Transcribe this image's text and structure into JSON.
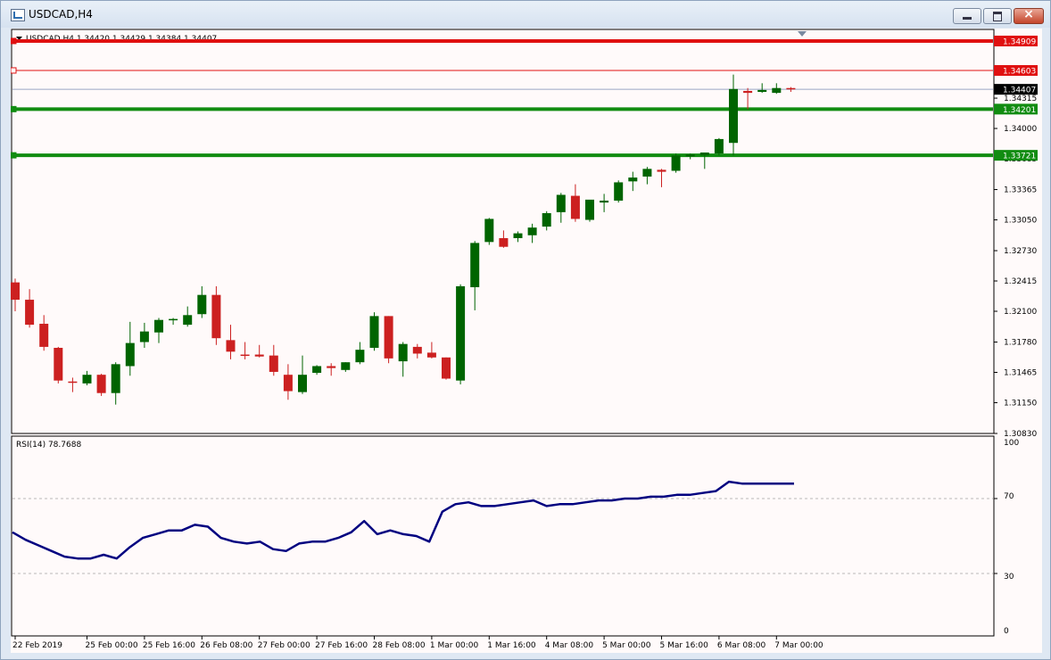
{
  "window": {
    "title": "USDCAD,H4"
  },
  "header": {
    "info": "USDCAD,H4  1.34420 1.34429 1.34384 1.34407"
  },
  "rsi": {
    "label": "RSI(14) 78.7688",
    "levels": [
      30,
      70
    ],
    "ticks": [
      "100",
      "70",
      "30",
      "0"
    ]
  },
  "colors": {
    "bull": "#006400",
    "bear": "#cc2020",
    "support": "#118c11",
    "resistance": "#e01010",
    "rsi_line": "#000080"
  },
  "price_axis_ticks": [
    "1.34315",
    "1.34000",
    "1.33685",
    "1.33365",
    "1.33050",
    "1.32730",
    "1.32415",
    "1.32100",
    "1.31780",
    "1.31465",
    "1.31150",
    "1.30830"
  ],
  "horizontal_lines": [
    {
      "label": "1.34909",
      "value": 1.34909,
      "color": "#e01010",
      "style": "thick"
    },
    {
      "label": "1.34603",
      "value": 1.34603,
      "color": "#e01010",
      "style": "thin"
    },
    {
      "label": "1.34201",
      "value": 1.34201,
      "color": "#118c11",
      "style": "thick"
    },
    {
      "label": "1.33721",
      "value": 1.33721,
      "color": "#118c11",
      "style": "thick"
    }
  ],
  "current_price": {
    "label": "1.34407",
    "value": 1.34407
  },
  "time_labels": [
    {
      "text": "22 Feb 2019",
      "i": 0
    },
    {
      "text": "25 Feb 00:00",
      "i": 5
    },
    {
      "text": "25 Feb 16:00",
      "i": 9
    },
    {
      "text": "26 Feb 08:00",
      "i": 13
    },
    {
      "text": "27 Feb 00:00",
      "i": 17
    },
    {
      "text": "27 Feb 16:00",
      "i": 21
    },
    {
      "text": "28 Feb 08:00",
      "i": 25
    },
    {
      "text": "1 Mar 00:00",
      "i": 29
    },
    {
      "text": "1 Mar 16:00",
      "i": 33
    },
    {
      "text": "4 Mar 08:00",
      "i": 37
    },
    {
      "text": "5 Mar 00:00",
      "i": 41
    },
    {
      "text": "5 Mar 16:00",
      "i": 45
    },
    {
      "text": "6 Mar 08:00",
      "i": 49
    },
    {
      "text": "7 Mar 00:00",
      "i": 53
    }
  ],
  "chart_data": {
    "type": "candlestick",
    "symbol": "USDCAD",
    "timeframe": "H4",
    "ylim": [
      1.3083,
      1.3502
    ],
    "candles": [
      {
        "o": 1.324,
        "h": 1.3244,
        "l": 1.321,
        "c": 1.3222
      },
      {
        "o": 1.3222,
        "h": 1.3233,
        "l": 1.3193,
        "c": 1.3196
      },
      {
        "o": 1.3197,
        "h": 1.3206,
        "l": 1.3169,
        "c": 1.3173
      },
      {
        "o": 1.3172,
        "h": 1.3173,
        "l": 1.3135,
        "c": 1.3138
      },
      {
        "o": 1.3137,
        "h": 1.3141,
        "l": 1.3126,
        "c": 1.3136
      },
      {
        "o": 1.3135,
        "h": 1.3148,
        "l": 1.3133,
        "c": 1.3144
      },
      {
        "o": 1.3144,
        "h": 1.3145,
        "l": 1.3122,
        "c": 1.3125
      },
      {
        "o": 1.3125,
        "h": 1.3157,
        "l": 1.3113,
        "c": 1.3155
      },
      {
        "o": 1.3153,
        "h": 1.3199,
        "l": 1.3143,
        "c": 1.3177
      },
      {
        "o": 1.3178,
        "h": 1.3198,
        "l": 1.3172,
        "c": 1.3189
      },
      {
        "o": 1.3188,
        "h": 1.3203,
        "l": 1.3177,
        "c": 1.3201
      },
      {
        "o": 1.3201,
        "h": 1.3203,
        "l": 1.3196,
        "c": 1.3202
      },
      {
        "o": 1.3196,
        "h": 1.3215,
        "l": 1.3194,
        "c": 1.3206
      },
      {
        "o": 1.3207,
        "h": 1.3236,
        "l": 1.3203,
        "c": 1.3227
      },
      {
        "o": 1.3227,
        "h": 1.3236,
        "l": 1.3175,
        "c": 1.3182
      },
      {
        "o": 1.318,
        "h": 1.3196,
        "l": 1.316,
        "c": 1.3168
      },
      {
        "o": 1.3165,
        "h": 1.3178,
        "l": 1.316,
        "c": 1.3164
      },
      {
        "o": 1.3165,
        "h": 1.3175,
        "l": 1.3162,
        "c": 1.3163
      },
      {
        "o": 1.3164,
        "h": 1.3175,
        "l": 1.3143,
        "c": 1.3147
      },
      {
        "o": 1.3144,
        "h": 1.3155,
        "l": 1.3118,
        "c": 1.3127
      },
      {
        "o": 1.3126,
        "h": 1.3164,
        "l": 1.3124,
        "c": 1.3144
      },
      {
        "o": 1.3146,
        "h": 1.3154,
        "l": 1.3144,
        "c": 1.3153
      },
      {
        "o": 1.3153,
        "h": 1.3156,
        "l": 1.3143,
        "c": 1.3151
      },
      {
        "o": 1.3149,
        "h": 1.3157,
        "l": 1.3147,
        "c": 1.3157
      },
      {
        "o": 1.3157,
        "h": 1.3178,
        "l": 1.3155,
        "c": 1.317
      },
      {
        "o": 1.3172,
        "h": 1.3209,
        "l": 1.3169,
        "c": 1.3205
      },
      {
        "o": 1.3205,
        "h": 1.3205,
        "l": 1.3156,
        "c": 1.3161
      },
      {
        "o": 1.3158,
        "h": 1.3178,
        "l": 1.3142,
        "c": 1.3176
      },
      {
        "o": 1.3173,
        "h": 1.3176,
        "l": 1.3161,
        "c": 1.3166
      },
      {
        "o": 1.3167,
        "h": 1.3178,
        "l": 1.3161,
        "c": 1.3162
      },
      {
        "o": 1.3162,
        "h": 1.3162,
        "l": 1.3139,
        "c": 1.314
      },
      {
        "o": 1.3138,
        "h": 1.3238,
        "l": 1.3134,
        "c": 1.3236
      },
      {
        "o": 1.3235,
        "h": 1.3283,
        "l": 1.3211,
        "c": 1.3281
      },
      {
        "o": 1.3282,
        "h": 1.3307,
        "l": 1.3279,
        "c": 1.3306
      },
      {
        "o": 1.3286,
        "h": 1.3294,
        "l": 1.3276,
        "c": 1.3277
      },
      {
        "o": 1.3286,
        "h": 1.3293,
        "l": 1.3282,
        "c": 1.3291
      },
      {
        "o": 1.3289,
        "h": 1.3301,
        "l": 1.3281,
        "c": 1.3297
      },
      {
        "o": 1.3298,
        "h": 1.3314,
        "l": 1.3294,
        "c": 1.3312
      },
      {
        "o": 1.3313,
        "h": 1.3333,
        "l": 1.3302,
        "c": 1.3331
      },
      {
        "o": 1.333,
        "h": 1.3342,
        "l": 1.3303,
        "c": 1.3306
      },
      {
        "o": 1.3305,
        "h": 1.3323,
        "l": 1.3303,
        "c": 1.3326
      },
      {
        "o": 1.3323,
        "h": 1.3332,
        "l": 1.3313,
        "c": 1.3325
      },
      {
        "o": 1.3325,
        "h": 1.3346,
        "l": 1.3323,
        "c": 1.3344
      },
      {
        "o": 1.3345,
        "h": 1.3355,
        "l": 1.3335,
        "c": 1.3349
      },
      {
        "o": 1.335,
        "h": 1.336,
        "l": 1.3342,
        "c": 1.3358
      },
      {
        "o": 1.3357,
        "h": 1.3358,
        "l": 1.3339,
        "c": 1.3355
      },
      {
        "o": 1.3356,
        "h": 1.3374,
        "l": 1.3354,
        "c": 1.3372
      },
      {
        "o": 1.3371,
        "h": 1.3374,
        "l": 1.3368,
        "c": 1.3373
      },
      {
        "o": 1.3372,
        "h": 1.3375,
        "l": 1.3358,
        "c": 1.3375
      },
      {
        "o": 1.3374,
        "h": 1.339,
        "l": 1.3372,
        "c": 1.3389
      },
      {
        "o": 1.3385,
        "h": 1.3456,
        "l": 1.3372,
        "c": 1.3441
      },
      {
        "o": 1.3439,
        "h": 1.3442,
        "l": 1.342,
        "c": 1.3437
      },
      {
        "o": 1.3438,
        "h": 1.3447,
        "l": 1.3437,
        "c": 1.344
      },
      {
        "o": 1.3437,
        "h": 1.3447,
        "l": 1.3436,
        "c": 1.3442
      },
      {
        "o": 1.3442,
        "h": 1.3443,
        "l": 1.3438,
        "c": 1.3441
      }
    ],
    "rsi": {
      "name": "RSI(14)",
      "ylim": [
        0,
        100
      ],
      "values": [
        52,
        48,
        45,
        42,
        39,
        38,
        38,
        40,
        38,
        44,
        49,
        51,
        53,
        53,
        56,
        55,
        49,
        47,
        46,
        47,
        43,
        42,
        46,
        47,
        47,
        49,
        52,
        58,
        51,
        53,
        51,
        50,
        47,
        63,
        67,
        68,
        66,
        66,
        67,
        68,
        69,
        66,
        67,
        67,
        68,
        69,
        69,
        70,
        70,
        71,
        71,
        72,
        72,
        73,
        74,
        79,
        78,
        78,
        78,
        78,
        78
      ]
    }
  }
}
